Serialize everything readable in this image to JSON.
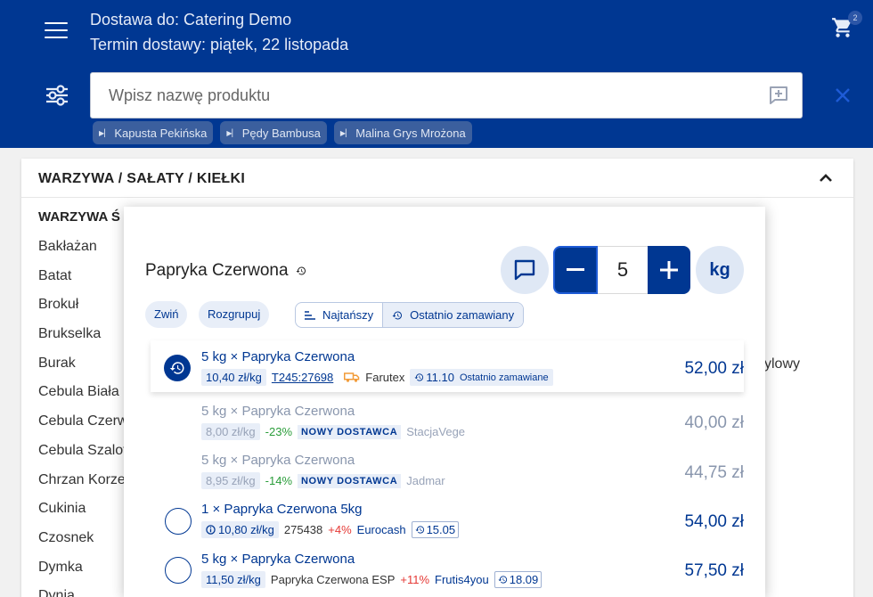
{
  "header": {
    "delivery_to": "Dostawa do: Catering Demo",
    "delivery_date": "Termin dostawy: piątek, 22 listopada",
    "cart_count": "2",
    "search_placeholder": "Wpisz nazwę produktu",
    "chips": [
      "Kapusta Pekińska",
      "Pędy Bambusa",
      "Malina Grys Mrożona"
    ]
  },
  "panel": {
    "title": "WARZYWA / SAŁATY / KIEŁKI",
    "subtitle": "WARZYWA Ś",
    "items": [
      "Bakłażan",
      "Batat",
      "Brokuł",
      "Brukselka",
      "Burak",
      "Cebula Biała",
      "Cebula Czerw",
      "Cebula Szalot",
      "Chrzan Korze",
      "Cukinia",
      "Czosnek",
      "Dymka",
      "Dynia"
    ],
    "right_text": "ylowy"
  },
  "modal": {
    "product_title": "Papryka Czerwona",
    "quantity": "5",
    "unit": "kg",
    "btn_collapse": "Zwiń",
    "btn_ungroup": "Rozgrupuj",
    "sort_cheapest": "Najtańszy",
    "sort_recent": "Ostatnio zamawiany",
    "offers": [
      {
        "title": "5 kg × Papryka Czerwona",
        "unit_price": "10,40 zł/kg",
        "code": "T245:27698",
        "supplier": "Farutex",
        "last_date": "11.10",
        "last_label": "Ostatnio zamawiane",
        "price": "52,00 zł"
      },
      {
        "title": "5 kg × Papryka Czerwona",
        "unit_price": "8,00 zł/kg",
        "diff": "-23%",
        "badge": "NOWY DOSTAWCA",
        "supplier": "StacjaVege",
        "price": "40,00 zł"
      },
      {
        "title": "5 kg × Papryka Czerwona",
        "unit_price": "8,95 zł/kg",
        "diff": "-14%",
        "badge": "NOWY DOSTAWCA",
        "supplier": "Jadmar",
        "price": "44,75 zł"
      },
      {
        "title": "1 × Papryka Czerwona 5kg",
        "unit_price": "10,80 zł/kg",
        "code": "275438",
        "diff": "+4%",
        "supplier": "Eurocash",
        "last_date": "15.05",
        "price": "54,00 zł"
      },
      {
        "title": "5 kg × Papryka Czerwona",
        "unit_price": "11,50 zł/kg",
        "code": "Papryka Czerwona ESP",
        "diff": "+11%",
        "supplier": "Frutis4you",
        "last_date": "18.09",
        "price": "57,50 zł"
      }
    ]
  },
  "colors": {
    "primary": "#003792",
    "light_blue": "#e8eef8",
    "green": "#2a9d3a",
    "red": "#e53935",
    "truck": "#f29b38"
  }
}
